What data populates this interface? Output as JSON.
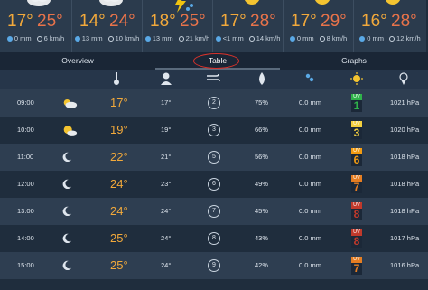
{
  "days": [
    {
      "hi": "17°",
      "lo": "25°",
      "icon": "cloud-icon",
      "a": "0 mm",
      "b": "6 km/h"
    },
    {
      "hi": "14°",
      "lo": "24°",
      "icon": "cloud-icon",
      "a": "13 mm",
      "b": "10 km/h"
    },
    {
      "hi": "18°",
      "lo": "25°",
      "icon": "thunderstorm-icon",
      "a": "13 mm",
      "b": "21 km/h"
    },
    {
      "hi": "17°",
      "lo": "28°",
      "icon": "sun-icon",
      "a": "<1 mm",
      "b": "14 km/h"
    },
    {
      "hi": "17°",
      "lo": "29°",
      "icon": "sun-icon",
      "a": "0 mm",
      "b": "8 km/h"
    },
    {
      "hi": "16°",
      "lo": "28°",
      "icon": "sun-icon",
      "a": "0 mm",
      "b": "12 km/h"
    }
  ],
  "tabs": [
    "Overview",
    "Table",
    "Graphs"
  ],
  "header_icons": [
    "thermometer-icon",
    "person-icon",
    "wind-icon",
    "humidity-icon",
    "rain-icon",
    "uv-sun-icon",
    "pressure-icon"
  ],
  "rows": [
    {
      "time": "09:00",
      "icon": "partly-cloudy-icon",
      "temp": "17°",
      "feels": "17°",
      "wind": "2",
      "hum": "75%",
      "rain": "0.0 mm",
      "uv": "1",
      "uvcolor": "#2fb24a",
      "pres": "1021 hPa"
    },
    {
      "time": "10:00",
      "icon": "sun-cloud-icon",
      "temp": "19°",
      "feels": "19°",
      "wind": "3",
      "hum": "66%",
      "rain": "0.0 mm",
      "uv": "3",
      "uvcolor": "#f4d03f",
      "pres": "1020 hPa"
    },
    {
      "time": "11:00",
      "icon": "moon-icon",
      "temp": "22°",
      "feels": "21°",
      "wind": "5",
      "hum": "56%",
      "rain": "0.0 mm",
      "uv": "6",
      "uvcolor": "#f39c12",
      "pres": "1018 hPa"
    },
    {
      "time": "12:00",
      "icon": "moon-icon",
      "temp": "24°",
      "feels": "23°",
      "wind": "6",
      "hum": "49%",
      "rain": "0.0 mm",
      "uv": "7",
      "uvcolor": "#e67e22",
      "pres": "1018 hPa"
    },
    {
      "time": "13:00",
      "icon": "moon-icon",
      "temp": "24°",
      "feels": "24°",
      "wind": "7",
      "hum": "45%",
      "rain": "0.0 mm",
      "uv": "8",
      "uvcolor": "#c0392b",
      "pres": "1018 hPa"
    },
    {
      "time": "14:00",
      "icon": "moon-icon",
      "temp": "25°",
      "feels": "24°",
      "wind": "8",
      "hum": "43%",
      "rain": "0.0 mm",
      "uv": "8",
      "uvcolor": "#c0392b",
      "pres": "1017 hPa"
    },
    {
      "time": "15:00",
      "icon": "moon-icon",
      "temp": "25°",
      "feels": "24°",
      "wind": "9",
      "hum": "42%",
      "rain": "0.0 mm",
      "uv": "7",
      "uvcolor": "#e67e22",
      "pres": "1016 hPa"
    }
  ]
}
